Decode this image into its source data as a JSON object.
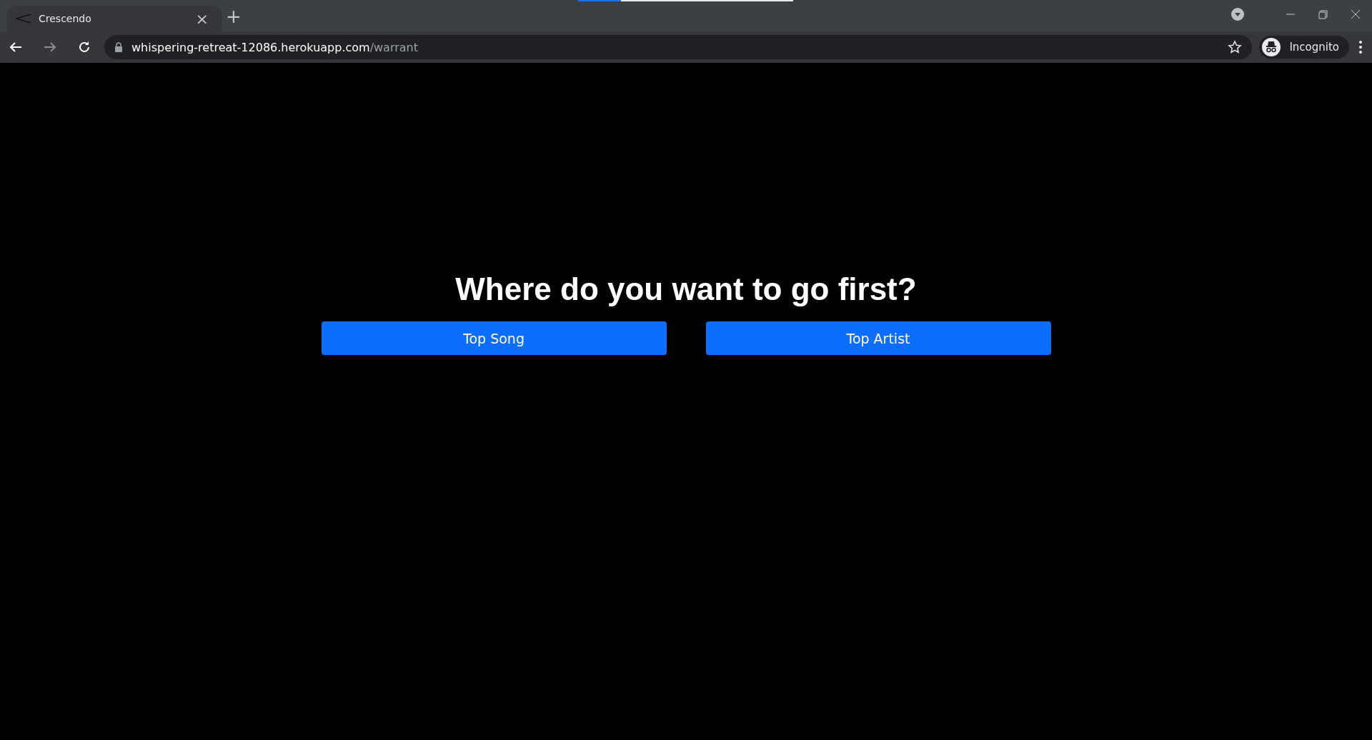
{
  "browser": {
    "tab": {
      "title": "Crescendo",
      "close": "×"
    },
    "new_tab": "+",
    "loading": {
      "level": 0.2
    },
    "address": {
      "host": "whispering-retreat-12086.herokuapp.com",
      "path": "/warrant"
    },
    "profile": "Incognito"
  },
  "page": {
    "heading": "Where do you want to go first?",
    "buttons": [
      "Top Song",
      "Top Artist"
    ]
  }
}
